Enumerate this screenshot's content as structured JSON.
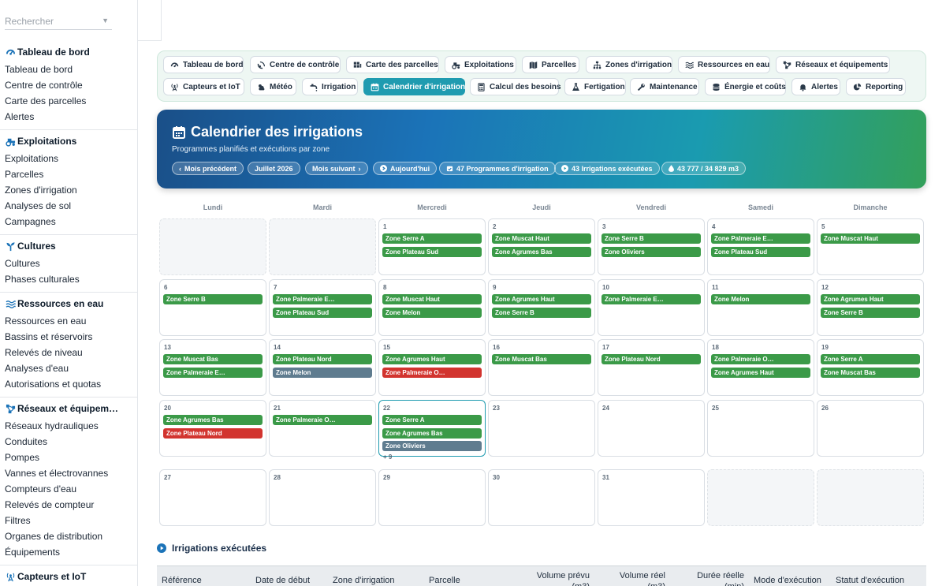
{
  "sidebar": {
    "search_placeholder": "Rechercher",
    "sections": [
      {
        "title": "Tableau de bord",
        "icon": "gauge-icon",
        "items": [
          "Tableau de bord",
          "Centre de contrôle",
          "Carte des parcelles",
          "Alertes"
        ]
      },
      {
        "title": "Exploitations",
        "icon": "tractor-icon",
        "items": [
          "Exploitations",
          "Parcelles",
          "Zones d'irrigation",
          "Analyses de sol",
          "Campagnes"
        ]
      },
      {
        "title": "Cultures",
        "icon": "seedling-icon",
        "items": [
          "Cultures",
          "Phases culturales"
        ]
      },
      {
        "title": "Ressources en eau",
        "icon": "water-icon",
        "items": [
          "Ressources en eau",
          "Bassins et réservoirs",
          "Relevés de niveau",
          "Analyses d'eau",
          "Autorisations et quotas"
        ]
      },
      {
        "title": "Réseaux et équipem…",
        "icon": "network-icon",
        "items": [
          "Réseaux hydrauliques",
          "Conduites",
          "Pompes",
          "Vannes et électrovannes",
          "Compteurs d'eau",
          "Relevés de compteur",
          "Filtres",
          "Organes de distribution",
          "Équipements"
        ]
      },
      {
        "title": "Capteurs et IoT",
        "icon": "antenna-icon",
        "items": []
      }
    ]
  },
  "nav": {
    "row1": [
      {
        "label": "Tableau de bord",
        "icon": "gauge-icon"
      },
      {
        "label": "Centre de contrôle",
        "icon": "satellite-dish-icon"
      },
      {
        "label": "Carte des parcelles",
        "icon": "grid-map-icon"
      },
      {
        "label": "Exploitations",
        "icon": "tractor-icon"
      },
      {
        "label": "Parcelles",
        "icon": "map-icon"
      },
      {
        "label": "Zones d'irrigation",
        "icon": "sitemap-icon"
      },
      {
        "label": "Ressources en eau",
        "icon": "water-icon"
      },
      {
        "label": "Réseaux et équipements",
        "icon": "network-icon"
      }
    ],
    "row2": [
      {
        "label": "Capteurs et IoT",
        "icon": "antenna-icon"
      },
      {
        "label": "Météo",
        "icon": "cloud-sun-icon"
      },
      {
        "label": "Irrigation",
        "icon": "faucet-icon"
      },
      {
        "label": "Calendrier d'irrigation",
        "icon": "calendar-icon",
        "active": true
      },
      {
        "label": "Calcul des besoins",
        "icon": "calculator-icon"
      },
      {
        "label": "Fertigation",
        "icon": "flask-icon"
      },
      {
        "label": "Maintenance",
        "icon": "wrench-icon"
      },
      {
        "label": "Énergie et coûts",
        "icon": "coins-icon"
      },
      {
        "label": "Alertes",
        "icon": "bell-icon"
      },
      {
        "label": "Reporting",
        "icon": "pie-chart-icon"
      }
    ]
  },
  "hero": {
    "title": "Calendrier des irrigations",
    "subtitle": "Programmes planifiés et exécutions par zone",
    "chips": {
      "prev": "Mois précédent",
      "month": "Juillet 2026",
      "next": "Mois suivant",
      "today": "Aujourd'hui",
      "programs": "47 Programmes d'irrigation",
      "executed": "43 Irrigations exécutées",
      "volume": "43 777 / 34 829 m3"
    }
  },
  "calendar": {
    "weekdays": [
      "Lundi",
      "Mardi",
      "Mercredi",
      "Jeudi",
      "Vendredi",
      "Samedi",
      "Dimanche"
    ],
    "colors": {
      "green": "#3b9a48",
      "red": "#d2342f",
      "gray": "#5f7c8f"
    },
    "weeks": [
      [
        null,
        null,
        {
          "day": "1",
          "events": [
            [
              "Zone Serre A",
              "green"
            ],
            [
              "Zone Plateau Sud",
              "green"
            ]
          ]
        },
        {
          "day": "2",
          "events": [
            [
              "Zone Muscat Haut",
              "green"
            ],
            [
              "Zone Agrumes Bas",
              "green"
            ]
          ]
        },
        {
          "day": "3",
          "events": [
            [
              "Zone Serre B",
              "green"
            ],
            [
              "Zone Oliviers",
              "green"
            ]
          ]
        },
        {
          "day": "4",
          "events": [
            [
              "Zone Palmeraie E…",
              "green"
            ],
            [
              "Zone Plateau Sud",
              "green"
            ]
          ]
        },
        {
          "day": "5",
          "events": [
            [
              "Zone Muscat Haut",
              "green"
            ]
          ]
        }
      ],
      [
        {
          "day": "6",
          "events": [
            [
              "Zone Serre B",
              "green"
            ]
          ]
        },
        {
          "day": "7",
          "events": [
            [
              "Zone Palmeraie E…",
              "green"
            ],
            [
              "Zone Plateau Sud",
              "green"
            ]
          ]
        },
        {
          "day": "8",
          "events": [
            [
              "Zone Muscat Haut",
              "green"
            ],
            [
              "Zone Melon",
              "green"
            ]
          ]
        },
        {
          "day": "9",
          "events": [
            [
              "Zone Agrumes Haut",
              "green"
            ],
            [
              "Zone Serre B",
              "green"
            ]
          ]
        },
        {
          "day": "10",
          "events": [
            [
              "Zone Palmeraie E…",
              "green"
            ]
          ]
        },
        {
          "day": "11",
          "events": [
            [
              "Zone Melon",
              "green"
            ]
          ]
        },
        {
          "day": "12",
          "events": [
            [
              "Zone Agrumes Haut",
              "green"
            ],
            [
              "Zone Serre B",
              "green"
            ]
          ]
        }
      ],
      [
        {
          "day": "13",
          "events": [
            [
              "Zone Muscat Bas",
              "green"
            ],
            [
              "Zone Palmeraie E…",
              "green"
            ]
          ]
        },
        {
          "day": "14",
          "events": [
            [
              "Zone Plateau Nord",
              "green"
            ],
            [
              "Zone Melon",
              "gray"
            ]
          ]
        },
        {
          "day": "15",
          "events": [
            [
              "Zone Agrumes Haut",
              "green"
            ],
            [
              "Zone Palmeraie O…",
              "red"
            ]
          ]
        },
        {
          "day": "16",
          "events": [
            [
              "Zone Muscat Bas",
              "green"
            ]
          ]
        },
        {
          "day": "17",
          "events": [
            [
              "Zone Plateau Nord",
              "green"
            ]
          ]
        },
        {
          "day": "18",
          "events": [
            [
              "Zone Palmeraie O…",
              "green"
            ],
            [
              "Zone Agrumes Haut",
              "green"
            ]
          ]
        },
        {
          "day": "19",
          "events": [
            [
              "Zone Serre A",
              "green"
            ],
            [
              "Zone Muscat Bas",
              "green"
            ]
          ]
        }
      ],
      [
        {
          "day": "20",
          "events": [
            [
              "Zone Agrumes Bas",
              "green"
            ],
            [
              "Zone Plateau Nord",
              "red"
            ]
          ]
        },
        {
          "day": "21",
          "events": [
            [
              "Zone Palmeraie O…",
              "green"
            ]
          ]
        },
        {
          "day": "22",
          "today": true,
          "events": [
            [
              "Zone Serre A",
              "green"
            ],
            [
              "Zone Agrumes Bas",
              "green"
            ],
            [
              "Zone Oliviers",
              "gray"
            ]
          ],
          "more": "+ 9"
        },
        {
          "day": "23",
          "events": []
        },
        {
          "day": "24",
          "events": []
        },
        {
          "day": "25",
          "events": []
        },
        {
          "day": "26",
          "events": []
        }
      ],
      [
        {
          "day": "27",
          "events": []
        },
        {
          "day": "28",
          "events": []
        },
        {
          "day": "29",
          "events": []
        },
        {
          "day": "30",
          "events": []
        },
        {
          "day": "31",
          "events": []
        },
        null,
        null
      ]
    ]
  },
  "executed": {
    "title": "Irrigations exécutées",
    "columns": [
      "Référence",
      "Date de début",
      "Zone d'irrigation",
      "Parcelle",
      "Volume prévu (m3)",
      "Volume réel (m3)",
      "Durée réelle (min)",
      "Mode d'exécution",
      "Statut d'exécution"
    ]
  }
}
